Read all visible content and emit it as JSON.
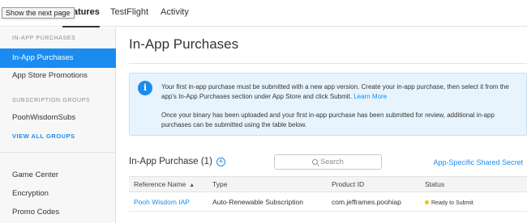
{
  "topbar": {
    "tooltip": "Show the next page",
    "tabs": [
      {
        "label": "Features",
        "active": true
      },
      {
        "label": "TestFlight",
        "active": false
      },
      {
        "label": "Activity",
        "active": false
      }
    ]
  },
  "sidebar": {
    "iap_header": "IN-APP PURCHASES",
    "iap_items": [
      "In-App Purchases",
      "App Store Promotions"
    ],
    "subs_header": "SUBSCRIPTION GROUPS",
    "subs_items": [
      "PoohWisdomSubs"
    ],
    "view_all": "VIEW ALL GROUPS",
    "bottom_items": [
      "Game Center",
      "Encryption",
      "Promo Codes"
    ]
  },
  "main": {
    "title": "In-App Purchases",
    "info": {
      "icon": "info-icon",
      "paragraph1": "Your first in-app purchase must be submitted with a new app version. Create your in-app purchase, then select it from the app's In-App Purchases section under App Store and click Submit.",
      "learn_more": "Learn More",
      "paragraph2": "Once your binary has been uploaded and your first in-app purchase has been submitted for review, additional in-app purchases can be submitted using the table below."
    },
    "section_title": "In-App Purchase (1)",
    "search_placeholder": "Search",
    "shared_secret": "App-Specific Shared Secret",
    "table": {
      "headers": [
        "Reference Name",
        "Type",
        "Product ID",
        "Status"
      ],
      "rows": [
        [
          "Pooh Wisdom IAP",
          "Auto-Renewable Subscription",
          "com.jefframes.poohiap",
          "Ready to Submit"
        ]
      ]
    }
  },
  "colors": {
    "accent": "#1a8cf0",
    "info_background": "#e8f4fd",
    "status_ready": "#f1c40f"
  }
}
